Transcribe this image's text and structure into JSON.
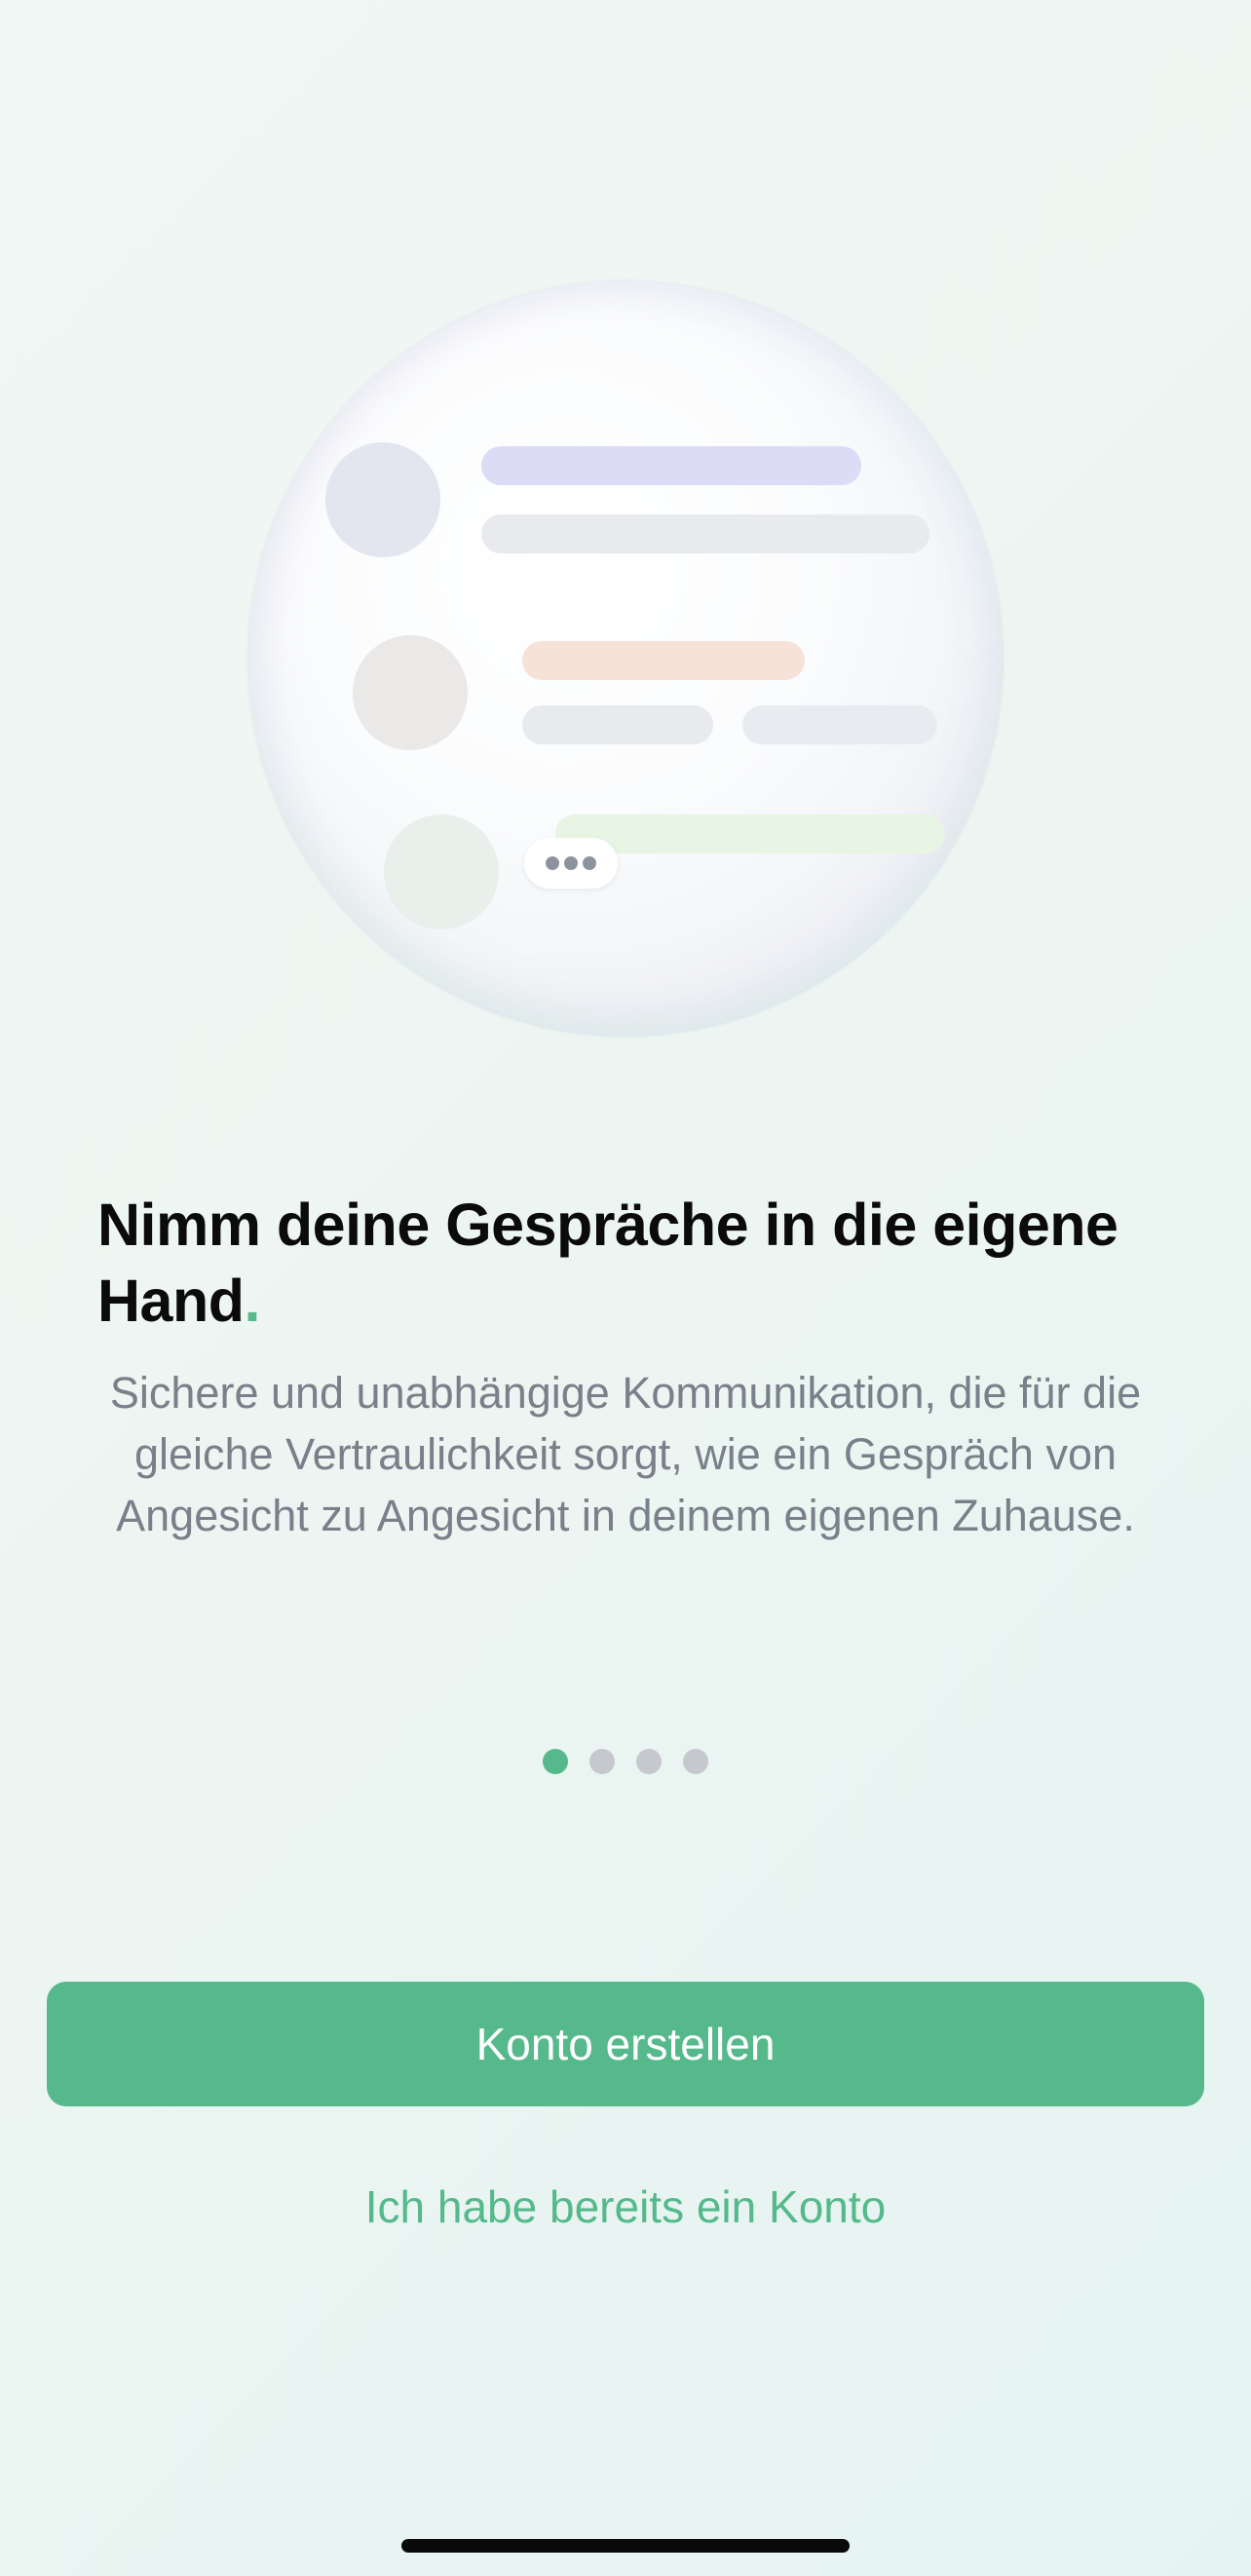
{
  "onboarding": {
    "title_main": "Nimm deine Gespräche in die eigene Hand",
    "title_dot": ".",
    "subtitle": "Sichere und unabhängige Kommunikation, die für die gleiche Vertraulichkeit sorgt, wie ein Gespräch von Angesicht zu Angesicht in deinem eigenen Zuhause.",
    "pagination": {
      "total_pages": 4,
      "current_page": 1
    }
  },
  "actions": {
    "create_account_label": "Konto erstellen",
    "existing_account_label": "Ich habe bereits ein Konto"
  },
  "illustration": {
    "icon": "chat-list-illustration",
    "typing_icon": "typing-ellipsis-icon"
  },
  "colors": {
    "accent": "#56b98c",
    "title_text": "#0b0b0b",
    "body_text": "#7a808a",
    "inactive_dot": "#c5c9ce",
    "bar_purple": "#dcdcf7",
    "bar_orange": "#f6e2d9",
    "bar_green": "#e8f4e4",
    "bar_gray": "#e8eaee"
  }
}
